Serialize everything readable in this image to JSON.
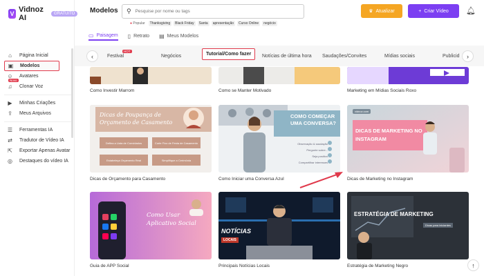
{
  "app": {
    "logo_text": "Vidnoz AI",
    "logo_mark": "V",
    "plan_badge": "GRATUITO"
  },
  "sidebar": {
    "items": [
      {
        "label": "Página Inicial",
        "icon": "home-icon",
        "glyph": "⌂"
      },
      {
        "label": "Modelos",
        "icon": "templates-icon",
        "glyph": "▣"
      },
      {
        "label": "Avatares",
        "icon": "avatar-icon",
        "glyph": "☺"
      },
      {
        "label": "Clonar Voz",
        "icon": "voice-icon",
        "glyph": "♫",
        "badge": "Novo"
      },
      {
        "label": "Minhas Criações",
        "icon": "creations-icon",
        "glyph": "▶"
      },
      {
        "label": "Meus Arquivos",
        "icon": "upload-icon",
        "glyph": "⇪"
      },
      {
        "label": "Ferramentas IA",
        "icon": "tools-icon",
        "glyph": "☰"
      },
      {
        "label": "Tradutor de Vídeo IA",
        "icon": "translate-icon",
        "glyph": "⇄"
      },
      {
        "label": "Exportar Apenas Avatar",
        "icon": "export-icon",
        "glyph": "⇱"
      },
      {
        "label": "Destaques do vídeo IA",
        "icon": "highlights-icon",
        "glyph": "◎"
      }
    ]
  },
  "header": {
    "title": "Modelos",
    "search_placeholder": "Pesquise por nome ou tags",
    "popular_label": "Popular",
    "tags": [
      "Thanksgiving",
      "Black Friday",
      "Santa",
      "apresentação",
      "Curso Online",
      "negócio"
    ],
    "upgrade_label": "Atualizar",
    "create_label": "Criar Vídeo"
  },
  "orientation_tabs": [
    "Paisagem",
    "Retrato",
    "Meus Modelos"
  ],
  "categories": {
    "items": [
      "Festival",
      "Negócios",
      "Tutorial/Como fazer",
      "Notícias de última hora",
      "Saudações/Convites",
      "Mídias sociais",
      "Publicid"
    ],
    "hot_badge": "HOT",
    "active": "Tutorial/Como fazer"
  },
  "cards": [
    {
      "caption": "Como Investir Marrom"
    },
    {
      "caption": "Como se Manter Motivado"
    },
    {
      "caption": "Marketing em Mídias Sociais Roxo"
    },
    {
      "caption": "Dicas de Orçamento para Casamento",
      "title": "Dicas de Poupança de Orçamento de Casamento",
      "boxes": [
        "Defina a Lista de Convidados",
        "Corte Fixo de Festa de Casamento",
        "Estabeleça Orçamento Real",
        "Simplifique a Cerimônia"
      ]
    },
    {
      "caption": "Como Iniciar uma Conversa Azul",
      "title": "COMO COMEÇAR UMA CONVERSA?",
      "list": [
        "Observação & saudação",
        "Pergunte sobre...",
        "Seja positivo",
        "Compartilhar interesses"
      ]
    },
    {
      "caption": "Dicas de Marketing no Instagram",
      "title": "DICAS DE MARKETING NO INSTAGRAM",
      "badge": "vidnoz.com"
    },
    {
      "caption": "Guia de APP Social",
      "title": "Como Usar Aplicativo Social"
    },
    {
      "caption": "Principais Notícias Locais",
      "title": "NOTÍCIAS",
      "subtitle": "LOCAIS"
    },
    {
      "caption": "Estratégia de Marketing Negro",
      "title": "ESTRATÉGIA DE MARKETING",
      "subtitle": "Dicas para iniciantes"
    }
  ],
  "colors": {
    "accent": "#7c3ff2",
    "highlight": "#e0394b",
    "upgrade": "#f5a623"
  }
}
